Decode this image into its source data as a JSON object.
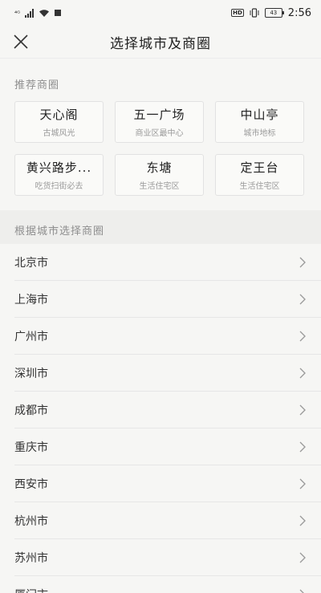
{
  "status_bar": {
    "signal_text": "⁴ᴳ",
    "time": "2:56",
    "hd": "HD",
    "battery": "43"
  },
  "header": {
    "title": "选择城市及商圈"
  },
  "recommended": {
    "label": "推荐商圈",
    "items": [
      {
        "name": "天心阁",
        "desc": "古城风光"
      },
      {
        "name": "五一广场",
        "desc": "商业区最中心"
      },
      {
        "name": "中山亭",
        "desc": "城市地标"
      },
      {
        "name": "黄兴路步...",
        "desc": "吃货扫街必去"
      },
      {
        "name": "东塘",
        "desc": "生活住宅区"
      },
      {
        "name": "定王台",
        "desc": "生活住宅区"
      }
    ]
  },
  "cities": {
    "label": "根据城市选择商圈",
    "items": [
      "北京市",
      "上海市",
      "广州市",
      "深圳市",
      "成都市",
      "重庆市",
      "西安市",
      "杭州市",
      "苏州市",
      "厦门市"
    ]
  },
  "icons": {
    "close": "close-icon",
    "chevron": "chevron-right-icon"
  },
  "colors": {
    "background": "#f6f6f4",
    "band": "#eeeeec",
    "muted_text": "#8e8e8e"
  }
}
